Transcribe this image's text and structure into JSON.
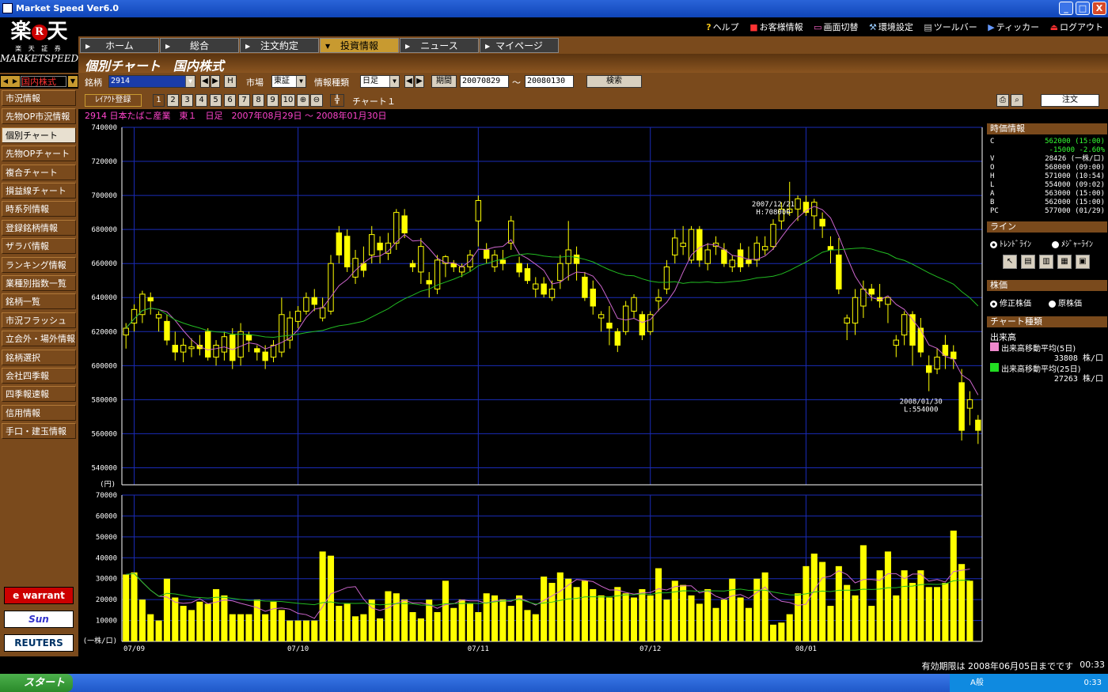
{
  "window": {
    "title": "Market Speed Ver6.0",
    "min": "_",
    "max": "□",
    "close": "X"
  },
  "toplinks": [
    "ヘルプ",
    "お客様情報",
    "画面切替",
    "環境設定",
    "ツールバー",
    "ティッカー",
    "ログアウト"
  ],
  "logo": {
    "text": "楽",
    "r": "R",
    "text2": "天",
    "sub": "楽 天 証 券",
    "brand": "MARKETSPEED"
  },
  "market_selector": "国内株式",
  "nav": [
    "市況情報",
    "先物OP市況情報",
    "個別チャート",
    "先物OPチャート",
    "複合チャート",
    "損益線チャート",
    "時系列情報",
    "登録銘柄情報",
    "ザラバ情報",
    "ランキング情報",
    "業種別指数一覧",
    "銘柄一覧",
    "市況フラッシュ",
    "立会外・場外情報",
    "銘柄選択",
    "会社四季報",
    "四季報速報",
    "信用情報",
    "手口・建玉情報"
  ],
  "nav_active": 2,
  "side_logos": [
    "e warrant",
    "Sun",
    "REUTERS"
  ],
  "tabs": [
    {
      "label": "ホーム"
    },
    {
      "label": "総合"
    },
    {
      "label": "注文約定"
    },
    {
      "label": "投資情報"
    },
    {
      "label": "ニュース"
    },
    {
      "label": "マイページ"
    }
  ],
  "active_tab": 3,
  "header_title": "個別チャート　国内株式",
  "controls": {
    "code_label": "銘柄",
    "code": "2914",
    "h_btn": "H",
    "market_label": "市場",
    "market": "東証",
    "type_label": "情報種類",
    "type": "日足",
    "period_label": "期間",
    "from": "20070829",
    "tilde": "～",
    "to": "20080130",
    "search": "検索"
  },
  "controls2": {
    "layout": "ﾚｲｱｳﾄ登録",
    "presets": [
      "1",
      "2",
      "3",
      "4",
      "5",
      "6",
      "7",
      "8",
      "9",
      "10"
    ],
    "chart_name": "チャート１",
    "order": "注文"
  },
  "info_line": "2914 日本たばこ産業　東１　日足　2007年08月29日 ～ 2008年01月30日",
  "quote": {
    "title": "時価情報",
    "rows": [
      {
        "k": "C",
        "v": "562000 (15:00)",
        "c": "#33ff33"
      },
      {
        "k": "",
        "v": "-15000 -2.60%",
        "c": "#33ff33"
      },
      {
        "k": "V",
        "v": "28426 (一株/口)",
        "c": "#ffffff"
      },
      {
        "k": "O",
        "v": "568000 (09:00)",
        "c": "#ffffff"
      },
      {
        "k": "H",
        "v": "571000 (10:54)",
        "c": "#ffffff"
      },
      {
        "k": "L",
        "v": "554000 (09:02)",
        "c": "#ffffff"
      },
      {
        "k": "A",
        "v": "563000 (15:00)",
        "c": "#ffffff"
      },
      {
        "k": "B",
        "v": "562000 (15:00)",
        "c": "#ffffff"
      },
      {
        "k": "PC",
        "v": "577000 (01/29)",
        "c": "#ffffff"
      }
    ]
  },
  "line_panel": {
    "title": "ライン",
    "options": [
      "ﾄﾚﾝﾄﾞﾗｲﾝ",
      "ﾒｼﾞｬｰﾗｲﾝ"
    ]
  },
  "stock_price_panel": {
    "title": "株価",
    "options": [
      "修正株価",
      "原株価"
    ]
  },
  "chart_type_panel": {
    "title": "チャート種類",
    "volume": "出来高",
    "ma5_label": "出来高移動平均(5日)",
    "ma5_value": "33808 株/口",
    "ma25_label": "出来高移動平均(25日)",
    "ma25_value": "27263 株/口"
  },
  "status": {
    "expire": "有効期限は 2008年06月05日までです",
    "clock": "00:33"
  },
  "taskbar": {
    "start": "スタート",
    "ime": "A般",
    "time": "0:33"
  },
  "chart_data": {
    "type": "candlestick",
    "price_unit": "(円)",
    "volume_unit": "(一株/口)",
    "ylim": [
      530000,
      740000
    ],
    "yticks": [
      540000,
      560000,
      580000,
      600000,
      620000,
      640000,
      660000,
      680000,
      700000,
      720000,
      740000
    ],
    "vol_ylim": [
      0,
      70000
    ],
    "vol_yticks": [
      10000,
      20000,
      30000,
      40000,
      50000,
      60000,
      70000
    ],
    "x_labels": [
      {
        "i": 1,
        "label": "07/09"
      },
      {
        "i": 21,
        "label": "07/10"
      },
      {
        "i": 43,
        "label": "07/11"
      },
      {
        "i": 64,
        "label": "07/12"
      },
      {
        "i": 83,
        "label": "08/01"
      }
    ],
    "annotations": [
      {
        "i": 79,
        "label1": "2007/12/21",
        "label2": "H:708000",
        "at": "high"
      },
      {
        "i": 98,
        "label1": "2008/01/30",
        "label2": "L:554000",
        "at": "low"
      }
    ],
    "colors": {
      "candle": "#ffff00",
      "grid": "#1a2cb8",
      "ma_short": "#cc66cc",
      "ma_long": "#22bb22",
      "vol": "#ffff00"
    },
    "candles": [
      {
        "o": 618000,
        "h": 625000,
        "l": 610000,
        "c": 622000
      },
      {
        "o": 625000,
        "h": 636000,
        "l": 620000,
        "c": 633000
      },
      {
        "o": 630000,
        "h": 644000,
        "l": 625000,
        "c": 642000
      },
      {
        "o": 640000,
        "h": 643000,
        "l": 630000,
        "c": 638000
      },
      {
        "o": 628000,
        "h": 632000,
        "l": 620000,
        "c": 630000
      },
      {
        "o": 626000,
        "h": 630000,
        "l": 612000,
        "c": 615000
      },
      {
        "o": 612000,
        "h": 620000,
        "l": 603000,
        "c": 608000
      },
      {
        "o": 608000,
        "h": 616000,
        "l": 602000,
        "c": 612000
      },
      {
        "o": 610000,
        "h": 616000,
        "l": 605000,
        "c": 611000
      },
      {
        "o": 612000,
        "h": 618000,
        "l": 606000,
        "c": 610000
      },
      {
        "o": 620000,
        "h": 622000,
        "l": 603000,
        "c": 605000
      },
      {
        "o": 605000,
        "h": 615000,
        "l": 600000,
        "c": 612000
      },
      {
        "o": 608000,
        "h": 620000,
        "l": 603000,
        "c": 617000
      },
      {
        "o": 618000,
        "h": 622000,
        "l": 598000,
        "c": 603000
      },
      {
        "o": 605000,
        "h": 625000,
        "l": 600000,
        "c": 620000
      },
      {
        "o": 618000,
        "h": 620000,
        "l": 608000,
        "c": 615000
      },
      {
        "o": 610000,
        "h": 612000,
        "l": 603000,
        "c": 608000
      },
      {
        "o": 608000,
        "h": 612000,
        "l": 598000,
        "c": 603000
      },
      {
        "o": 605000,
        "h": 615000,
        "l": 602000,
        "c": 612000
      },
      {
        "o": 608000,
        "h": 640000,
        "l": 605000,
        "c": 630000
      },
      {
        "o": 615000,
        "h": 632000,
        "l": 610000,
        "c": 628000
      },
      {
        "o": 626000,
        "h": 635000,
        "l": 622000,
        "c": 632000
      },
      {
        "o": 632000,
        "h": 643000,
        "l": 630000,
        "c": 640000
      },
      {
        "o": 640000,
        "h": 645000,
        "l": 632000,
        "c": 636000
      },
      {
        "o": 628000,
        "h": 640000,
        "l": 626000,
        "c": 634000
      },
      {
        "o": 632000,
        "h": 665000,
        "l": 630000,
        "c": 660000
      },
      {
        "o": 678000,
        "h": 682000,
        "l": 660000,
        "c": 665000
      },
      {
        "o": 676000,
        "h": 680000,
        "l": 655000,
        "c": 658000
      },
      {
        "o": 652000,
        "h": 668000,
        "l": 648000,
        "c": 663000
      },
      {
        "o": 660000,
        "h": 670000,
        "l": 652000,
        "c": 656000
      },
      {
        "o": 665000,
        "h": 682000,
        "l": 660000,
        "c": 677000
      },
      {
        "o": 672000,
        "h": 676000,
        "l": 660000,
        "c": 668000
      },
      {
        "o": 666000,
        "h": 678000,
        "l": 662000,
        "c": 672000
      },
      {
        "o": 672000,
        "h": 692000,
        "l": 668000,
        "c": 690000
      },
      {
        "o": 688000,
        "h": 692000,
        "l": 675000,
        "c": 678000
      },
      {
        "o": 660000,
        "h": 662000,
        "l": 655000,
        "c": 658000
      },
      {
        "o": 655000,
        "h": 675000,
        "l": 648000,
        "c": 670000
      },
      {
        "o": 650000,
        "h": 655000,
        "l": 640000,
        "c": 648000
      },
      {
        "o": 645000,
        "h": 665000,
        "l": 642000,
        "c": 662000
      },
      {
        "o": 660000,
        "h": 665000,
        "l": 652000,
        "c": 664000
      },
      {
        "o": 660000,
        "h": 662000,
        "l": 655000,
        "c": 658000
      },
      {
        "o": 655000,
        "h": 660000,
        "l": 652000,
        "c": 658000
      },
      {
        "o": 658000,
        "h": 668000,
        "l": 655000,
        "c": 665000
      },
      {
        "o": 685000,
        "h": 700000,
        "l": 670000,
        "c": 697000
      },
      {
        "o": 668000,
        "h": 672000,
        "l": 660000,
        "c": 663000
      },
      {
        "o": 658000,
        "h": 668000,
        "l": 655000,
        "c": 665000
      },
      {
        "o": 662000,
        "h": 668000,
        "l": 656000,
        "c": 660000
      },
      {
        "o": 672000,
        "h": 688000,
        "l": 668000,
        "c": 685000
      },
      {
        "o": 660000,
        "h": 664000,
        "l": 652000,
        "c": 655000
      },
      {
        "o": 657000,
        "h": 660000,
        "l": 648000,
        "c": 650000
      },
      {
        "o": 645000,
        "h": 652000,
        "l": 640000,
        "c": 648000
      },
      {
        "o": 648000,
        "h": 652000,
        "l": 640000,
        "c": 642000
      },
      {
        "o": 640000,
        "h": 650000,
        "l": 638000,
        "c": 645000
      },
      {
        "o": 650000,
        "h": 665000,
        "l": 645000,
        "c": 660000
      },
      {
        "o": 660000,
        "h": 685000,
        "l": 650000,
        "c": 668000
      },
      {
        "o": 665000,
        "h": 670000,
        "l": 650000,
        "c": 660000
      },
      {
        "o": 652000,
        "h": 655000,
        "l": 638000,
        "c": 640000
      },
      {
        "o": 645000,
        "h": 650000,
        "l": 630000,
        "c": 635000
      },
      {
        "o": 628000,
        "h": 632000,
        "l": 620000,
        "c": 630000
      },
      {
        "o": 625000,
        "h": 635000,
        "l": 612000,
        "c": 622000
      },
      {
        "o": 620000,
        "h": 622000,
        "l": 608000,
        "c": 612000
      },
      {
        "o": 620000,
        "h": 638000,
        "l": 618000,
        "c": 635000
      },
      {
        "o": 632000,
        "h": 642000,
        "l": 628000,
        "c": 640000
      },
      {
        "o": 630000,
        "h": 632000,
        "l": 615000,
        "c": 618000
      },
      {
        "o": 620000,
        "h": 632000,
        "l": 618000,
        "c": 630000
      },
      {
        "o": 638000,
        "h": 645000,
        "l": 632000,
        "c": 640000
      },
      {
        "o": 645000,
        "h": 662000,
        "l": 642000,
        "c": 658000
      },
      {
        "o": 665000,
        "h": 680000,
        "l": 660000,
        "c": 675000
      },
      {
        "o": 670000,
        "h": 682000,
        "l": 665000,
        "c": 672000
      },
      {
        "o": 662000,
        "h": 682000,
        "l": 660000,
        "c": 680000
      },
      {
        "o": 680000,
        "h": 682000,
        "l": 658000,
        "c": 662000
      },
      {
        "o": 660000,
        "h": 672000,
        "l": 656000,
        "c": 668000
      },
      {
        "o": 670000,
        "h": 676000,
        "l": 665000,
        "c": 672000
      },
      {
        "o": 668000,
        "h": 672000,
        "l": 658000,
        "c": 660000
      },
      {
        "o": 658000,
        "h": 665000,
        "l": 655000,
        "c": 662000
      },
      {
        "o": 668000,
        "h": 672000,
        "l": 655000,
        "c": 658000
      },
      {
        "o": 662000,
        "h": 670000,
        "l": 658000,
        "c": 660000
      },
      {
        "o": 662000,
        "h": 676000,
        "l": 658000,
        "c": 672000
      },
      {
        "o": 668000,
        "h": 676000,
        "l": 665000,
        "c": 670000
      },
      {
        "o": 670000,
        "h": 686000,
        "l": 668000,
        "c": 683000
      },
      {
        "o": 685000,
        "h": 696000,
        "l": 680000,
        "c": 692000
      },
      {
        "o": 690000,
        "h": 708000,
        "l": 688000,
        "c": 692000
      },
      {
        "o": 692000,
        "h": 700000,
        "l": 685000,
        "c": 698000
      },
      {
        "o": 696000,
        "h": 700000,
        "l": 688000,
        "c": 690000
      },
      {
        "o": 688000,
        "h": 698000,
        "l": 680000,
        "c": 696000
      },
      {
        "o": 686000,
        "h": 690000,
        "l": 675000,
        "c": 682000
      },
      {
        "o": 670000,
        "h": 676000,
        "l": 660000,
        "c": 668000
      },
      {
        "o": 665000,
        "h": 675000,
        "l": 642000,
        "c": 645000
      },
      {
        "o": 625000,
        "h": 630000,
        "l": 615000,
        "c": 628000
      },
      {
        "o": 625000,
        "h": 645000,
        "l": 618000,
        "c": 640000
      },
      {
        "o": 635000,
        "h": 650000,
        "l": 628000,
        "c": 645000
      },
      {
        "o": 645000,
        "h": 648000,
        "l": 638000,
        "c": 642000
      },
      {
        "o": 640000,
        "h": 648000,
        "l": 634000,
        "c": 638000
      },
      {
        "o": 636000,
        "h": 640000,
        "l": 625000,
        "c": 640000
      },
      {
        "o": 612000,
        "h": 618000,
        "l": 605000,
        "c": 615000
      },
      {
        "o": 618000,
        "h": 632000,
        "l": 612000,
        "c": 630000
      },
      {
        "o": 630000,
        "h": 632000,
        "l": 600000,
        "c": 612000
      },
      {
        "o": 622000,
        "h": 628000,
        "l": 605000,
        "c": 608000
      },
      {
        "o": 600000,
        "h": 606000,
        "l": 585000,
        "c": 596000
      },
      {
        "o": 598000,
        "h": 610000,
        "l": 595000,
        "c": 605000
      },
      {
        "o": 612000,
        "h": 618000,
        "l": 598000,
        "c": 606000
      },
      {
        "o": 608000,
        "h": 612000,
        "l": 598000,
        "c": 604000
      },
      {
        "o": 590000,
        "h": 598000,
        "l": 556000,
        "c": 562000
      },
      {
        "o": 575000,
        "h": 585000,
        "l": 565000,
        "c": 580000
      },
      {
        "o": 568000,
        "h": 571000,
        "l": 554000,
        "c": 562000
      }
    ],
    "volume": [
      32000,
      33000,
      20000,
      13000,
      10000,
      30000,
      21000,
      17000,
      15000,
      19000,
      18000,
      25000,
      22000,
      13000,
      13000,
      13000,
      20000,
      13000,
      19000,
      15000,
      10000,
      10000,
      10000,
      10000,
      43000,
      41000,
      17000,
      18000,
      12000,
      13000,
      20000,
      11000,
      24000,
      23000,
      20000,
      14000,
      11000,
      20000,
      14000,
      29000,
      16000,
      20000,
      18000,
      14000,
      23000,
      22000,
      20000,
      17000,
      22000,
      15000,
      13000,
      31000,
      28000,
      33000,
      30000,
      26000,
      29000,
      25000,
      22000,
      21000,
      26000,
      23000,
      21000,
      25000,
      22000,
      35000,
      20000,
      29000,
      27000,
      22000,
      18000,
      25000,
      16000,
      20000,
      30000,
      21000,
      16000,
      30000,
      33000,
      8000,
      9000,
      13000,
      23000,
      36000,
      42000,
      38000,
      17000,
      36000,
      27000,
      22000,
      46000,
      17000,
      34000,
      43000,
      22000,
      34000,
      28000,
      34000,
      26000,
      26000,
      28000,
      53000,
      37000,
      29000
    ]
  }
}
